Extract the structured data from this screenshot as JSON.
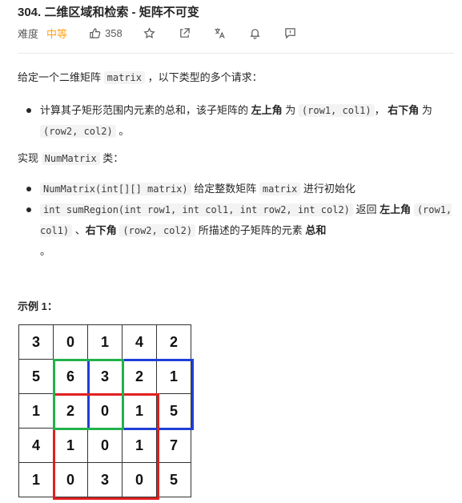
{
  "problem": {
    "title": "304. 二维区域和检索 - 矩阵不可变",
    "difficulty_label": "难度",
    "difficulty": "中等",
    "likes": "358"
  },
  "icons": {
    "like": "thumbs-up-icon",
    "star": "star-icon",
    "share": "share-icon",
    "translate": "translate-icon",
    "bell": "bell-icon",
    "feedback": "feedback-icon"
  },
  "desc": {
    "intro_prefix": "给定一个二维矩阵",
    "intro_code": "matrix",
    "intro_suffix": "，以下类型的多个请求：",
    "b1_pre": "计算其子矩形范围内元素的总和，该子矩阵的",
    "b1_tl": "左上角",
    "b1_mid": "为",
    "b1_code1": "(row1,  col1)",
    "b1_comma": "，",
    "b1_br": "右下角",
    "b1_mid2": "为",
    "b1_code2": "(row2,  col2)",
    "b1_end": "。",
    "impl_pre": "实现",
    "impl_code": "NumMatrix",
    "impl_suf": "类：",
    "b2_code": "NumMatrix(int[][] matrix)",
    "b2_mid": "给定整数矩阵",
    "b2_code2": "matrix",
    "b2_end": "进行初始化",
    "b3_code": "int sumRegion(int row1, int col1, int row2, int col2)",
    "b3_ret": "返回",
    "b3_tl": "左上角",
    "b3_code2": "(row1,  col1)",
    "b3_sep": "、",
    "b3_br": "右下角",
    "b3_code3": "(row2,  col2)",
    "b3_desc": "所描述的子矩阵的元素",
    "b3_sum": "总和",
    "b3_end": "。"
  },
  "example": {
    "title": "示例 1：",
    "matrix": [
      [
        "3",
        "0",
        "1",
        "4",
        "2"
      ],
      [
        "5",
        "6",
        "3",
        "2",
        "1"
      ],
      [
        "1",
        "2",
        "0",
        "1",
        "5"
      ],
      [
        "4",
        "1",
        "0",
        "1",
        "7"
      ],
      [
        "1",
        "0",
        "3",
        "0",
        "5"
      ]
    ],
    "highlight_colors": {
      "green": "#22b14c",
      "blue": "#1f3fd6",
      "red": "#e0201f"
    }
  }
}
